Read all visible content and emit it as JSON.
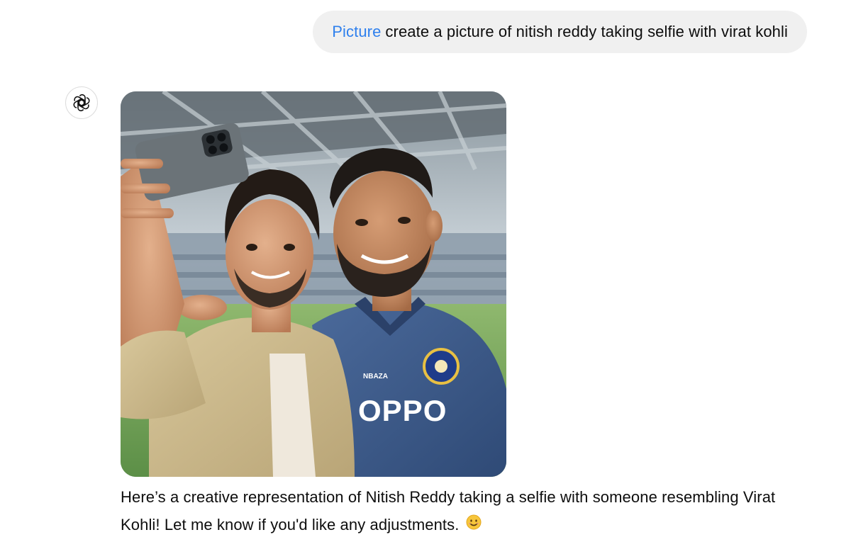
{
  "user_message": {
    "tool_label": "Picture",
    "text": "create a picture of nitish reddy taking selfie with virat kohli"
  },
  "assistant": {
    "avatar_icon": "openai-logo-icon",
    "image_icon": "generated-selfie-image",
    "jersey_text": "OPPO",
    "jersey_brand_text": "NBAZA",
    "response_text": "Here’s a creative representation of Nitish Reddy taking a selfie with someone resembling Virat Kohli! Let me know if you'd like any adjustments.",
    "emoji": "😊"
  },
  "colors": {
    "bubble_bg": "#f0f0f0",
    "tool_label": "#2f80ed",
    "jersey": "#3f5e8e"
  }
}
